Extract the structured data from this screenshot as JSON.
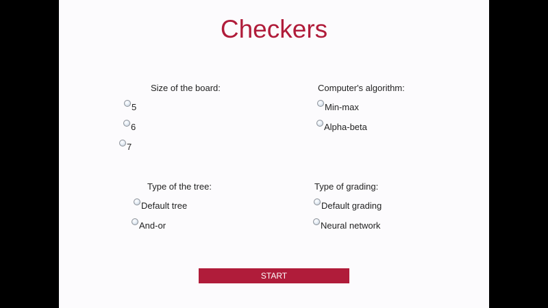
{
  "title": "Checkers",
  "groups": {
    "board_size": {
      "label": "Size of the board:",
      "options": [
        "5",
        "6",
        "7"
      ]
    },
    "algorithm": {
      "label": "Computer's algorithm:",
      "options": [
        "Min-max",
        "Alpha-beta"
      ]
    },
    "tree_type": {
      "label": "Type of the tree:",
      "options": [
        "Default tree",
        "And-or"
      ]
    },
    "grading": {
      "label": "Type of grading:",
      "options": [
        "Default grading",
        "Neural network"
      ]
    }
  },
  "start_label": "START",
  "colors": {
    "accent": "#b01c3a",
    "page_background": "#fcfbfd",
    "outer_background": "#000000"
  }
}
